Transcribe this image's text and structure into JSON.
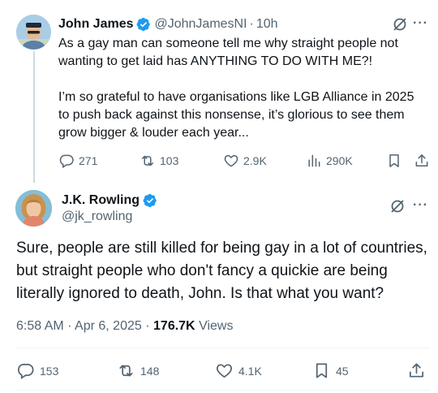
{
  "reply": {
    "name": "John James",
    "handle": "@JohnJamesNI",
    "separator": "·",
    "time": "10h",
    "more": "···",
    "paragraphs": [
      "As a gay man can someone tell me why straight people not wanting to get laid has ANYTHING TO DO WITH ME?!",
      "I’m so grateful to have organisations like LGB Alliance in 2025 to push back against this nonsense, it’s glorious to see them grow bigger & louder each year..."
    ],
    "stats": {
      "replies": "271",
      "reposts": "103",
      "likes": "2.9K",
      "views": "290K"
    }
  },
  "main": {
    "name": "J.K. Rowling",
    "handle": "@jk_rowling",
    "more": "···",
    "text": "Sure, people are still killed for being gay in a lot of countries, but straight people who don't fancy a quickie are being literally ignored to death, John. Is that what you want?",
    "time": "6:58 AM",
    "separator": "·",
    "date": "Apr 6, 2025",
    "views_count": "176.7K",
    "views_label": "Views",
    "stats": {
      "replies": "153",
      "reposts": "148",
      "likes": "4.1K",
      "bookmarks": "45"
    }
  },
  "colors": {
    "verified": "#1d9bf0",
    "muted": "#536471",
    "text": "#0f1419",
    "divider": "#eff3f4"
  },
  "icons": [
    "verified-badge-icon",
    "grok-icon",
    "more-icon",
    "reply-icon",
    "repost-icon",
    "like-icon",
    "views-icon",
    "bookmark-icon",
    "share-icon"
  ]
}
